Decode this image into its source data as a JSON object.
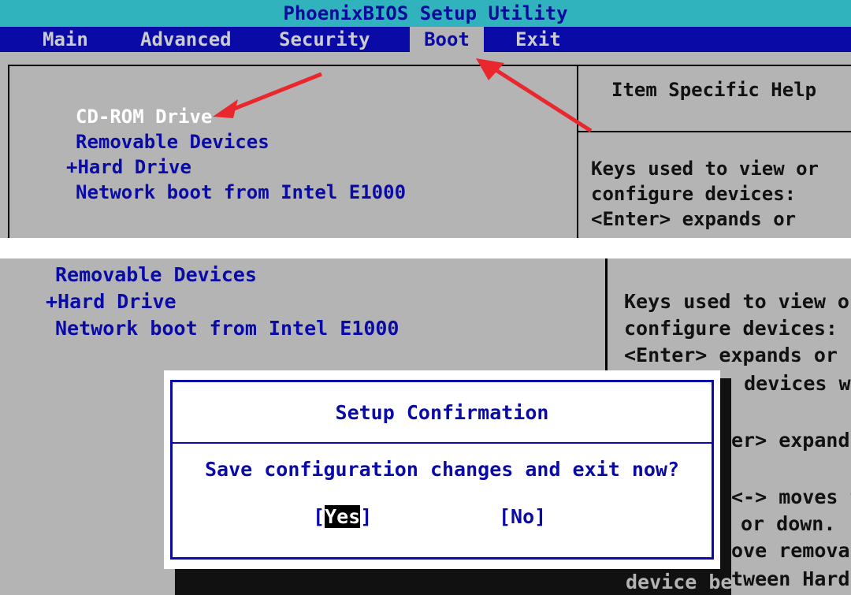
{
  "app": {
    "title": "PhoenixBIOS Setup Utility"
  },
  "menu": {
    "tabs": [
      {
        "label": "Main"
      },
      {
        "label": "Advanced"
      },
      {
        "label": "Security"
      },
      {
        "label": "Boot",
        "active": true
      },
      {
        "label": "Exit"
      }
    ]
  },
  "boot_menu": {
    "items": [
      {
        "label": "CD-ROM Drive",
        "selected": true
      },
      {
        "label": "Removable Devices"
      },
      {
        "label": "+Hard Drive"
      },
      {
        "label": "Network boot from Intel E1000"
      }
    ]
  },
  "help": {
    "title": "Item Specific Help",
    "lines": [
      "Keys used to view or",
      "configure devices:",
      "<Enter> expands or"
    ]
  },
  "bottom_help_visible": {
    "lines": [
      "Keys used to view o",
      "configure devices:",
      "<Enter> expands or"
    ],
    "partial_lines": [
      "s devices w",
      "er> expand",
      "<-> moves t",
      "or down.",
      "ove remova",
      "tween Hard"
    ],
    "shadow_text": "device be"
  },
  "dialog": {
    "title": "Setup Confirmation",
    "message": "Save configuration changes and exit now?",
    "yes_left": "[",
    "yes_label": "Yes",
    "yes_right": "]",
    "no_label": "[No]"
  },
  "colors": {
    "bios_gray": "#b4b4b4",
    "bios_blue": "#0a0aa6",
    "title_cyan": "#31b3bd",
    "annotation_red": "#e8282c"
  },
  "icons": {
    "annotation": "red-arrow-icon"
  }
}
